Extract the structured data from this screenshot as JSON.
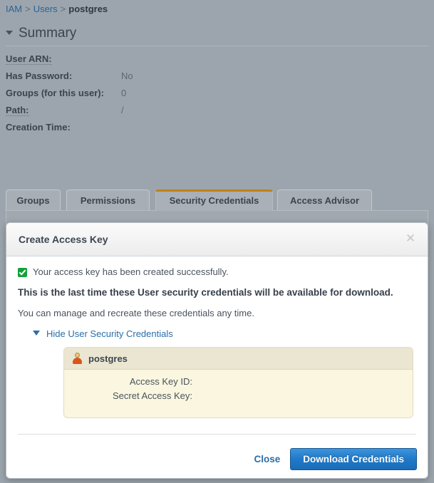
{
  "breadcrumb": {
    "items": [
      {
        "label": "IAM",
        "type": "link"
      },
      {
        "label": "Users",
        "type": "link"
      },
      {
        "label": "postgres",
        "type": "current"
      }
    ],
    "separator": ">"
  },
  "summary": {
    "title": "Summary",
    "caret": "caret-down-icon",
    "fields": [
      {
        "label": "User ARN:",
        "value": "",
        "dotted": true
      },
      {
        "label": "Has Password:",
        "value": "No",
        "dotted": false
      },
      {
        "label": "Groups (for this user):",
        "value": "0",
        "dotted": false
      },
      {
        "label": "Path:",
        "value": "/",
        "dotted": true
      },
      {
        "label": "Creation Time:",
        "value": "",
        "dotted": false
      }
    ]
  },
  "tabs": [
    {
      "label": "Groups",
      "active": false
    },
    {
      "label": "Permissions",
      "active": false
    },
    {
      "label": "Security Credentials",
      "active": true
    },
    {
      "label": "Access Advisor",
      "active": false
    }
  ],
  "modal": {
    "title": "Create Access Key",
    "close_icon": "close-icon",
    "success_message": "Your access key has been created successfully.",
    "warning_message": "This is the last time these User security credentials will be available for download.",
    "manage_message": "You can manage and recreate these credentials any time.",
    "toggle_label": "Hide User Security Credentials",
    "credentials": {
      "user_name": "postgres",
      "user_icon": "user-avatar-icon",
      "rows": [
        {
          "label": "Access Key ID:",
          "value": ""
        },
        {
          "label": "Secret Access Key:",
          "value": ""
        }
      ]
    },
    "footer": {
      "close_label": "Close",
      "download_label": "Download Credentials"
    }
  },
  "colors": {
    "page_background": "#9ca5ad",
    "accent_tab": "#c07f1b",
    "link": "#2a6fa8",
    "success": "#13a13a",
    "primary_button": "#2079c8",
    "credentials_panel": "#faf6df"
  }
}
